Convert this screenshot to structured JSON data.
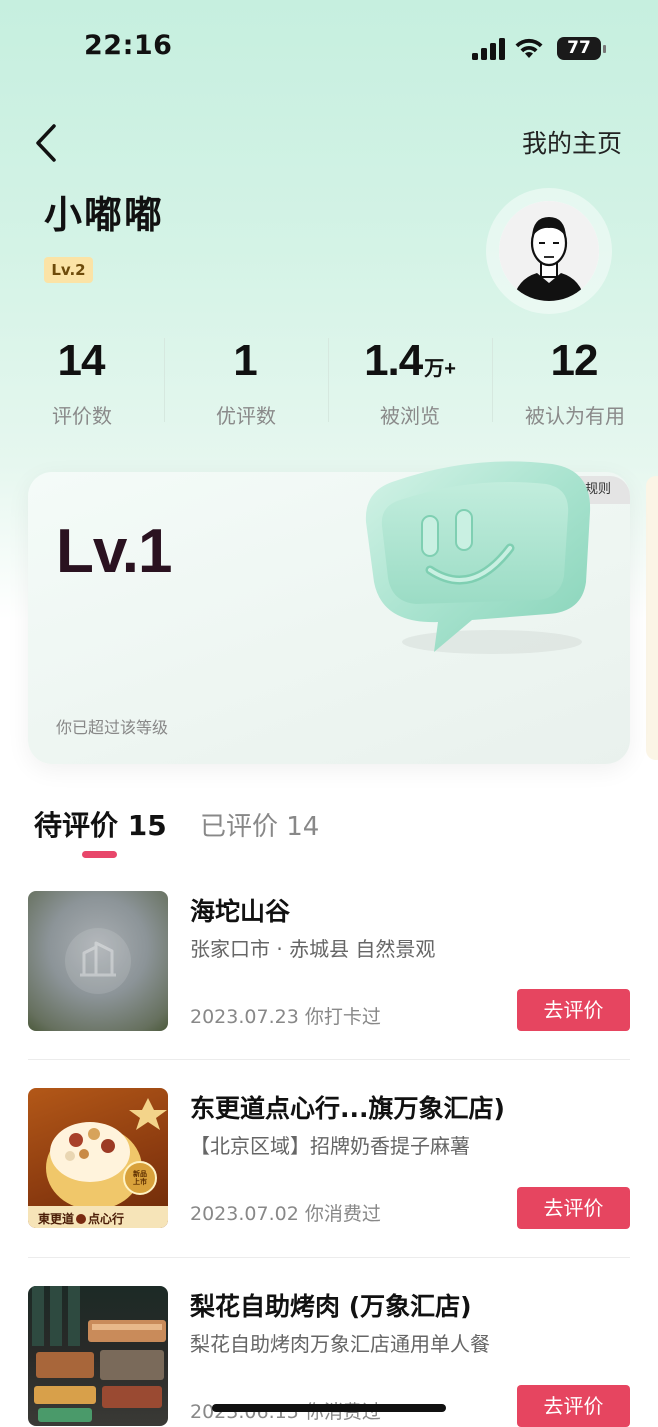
{
  "status_bar": {
    "time": "22:16",
    "battery": "77"
  },
  "header": {
    "home_link": "我的主页"
  },
  "profile": {
    "name": "小嘟嘟",
    "level_badge": "Lv.2"
  },
  "stats": [
    {
      "value": "14",
      "unit": "",
      "label": "评价数"
    },
    {
      "value": "1",
      "unit": "",
      "label": "优评数"
    },
    {
      "value": "1.4",
      "unit": "万+",
      "label": "被浏览"
    },
    {
      "value": "12",
      "unit": "",
      "label": "被认为有用"
    }
  ],
  "level_card": {
    "rules_label": "规则",
    "level": "Lv.1",
    "note": "你已超过该等级"
  },
  "tabs": [
    {
      "label": "待评价 15",
      "active": true
    },
    {
      "label": "已评价 14",
      "active": false
    }
  ],
  "items": [
    {
      "title": "海坨山谷",
      "subtitle": "张家口市 · 赤城县 自然景观",
      "date": "2023.07.23 你打卡过",
      "button": "去评价"
    },
    {
      "title": "东更道点心行...旗万象汇店)",
      "subtitle": "【北京区域】招牌奶香提子麻薯",
      "date": "2023.07.02 你消费过",
      "button": "去评价",
      "thumb_brand": "東更道",
      "thumb_brand2": "点心行",
      "thumb_tag": "新品上市"
    },
    {
      "title": "梨花自助烤肉 (万象汇店)",
      "subtitle": "梨花自助烤肉万象汇店通用单人餐",
      "date": "2023.06.15 你消费过",
      "button": "去评价"
    }
  ],
  "colors": {
    "accent": "#e64560",
    "tab_indicator": "#e8466a",
    "level_badge_bg": "#fbe3a6",
    "mascot": "#a9e3cf"
  },
  "icons": [
    "back-arrow-icon",
    "signal-icon",
    "wifi-icon",
    "battery-icon",
    "building-placeholder-icon",
    "smile-chat-mascot-icon"
  ]
}
